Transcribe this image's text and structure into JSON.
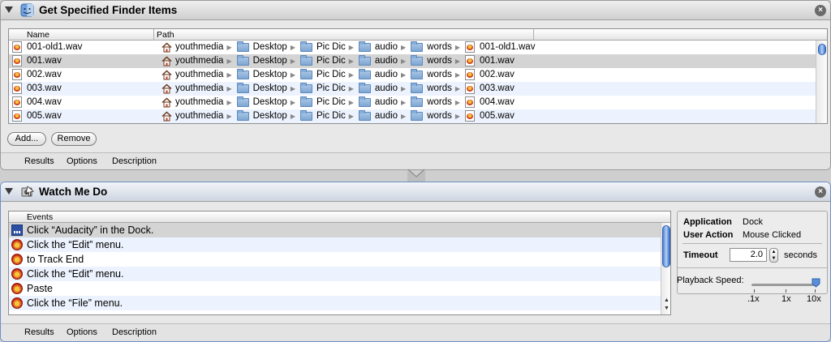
{
  "action1": {
    "title": "Get Specified Finder Items",
    "columns": {
      "name": "Name",
      "path": "Path"
    },
    "rows": [
      {
        "name": "001-old1.wav",
        "path": [
          "youthmedia",
          "Desktop",
          "Pic Dic",
          "audio",
          "words",
          "001-old1.wav"
        ]
      },
      {
        "name": "001.wav",
        "path": [
          "youthmedia",
          "Desktop",
          "Pic Dic",
          "audio",
          "words",
          "001.wav"
        ]
      },
      {
        "name": "002.wav",
        "path": [
          "youthmedia",
          "Desktop",
          "Pic Dic",
          "audio",
          "words",
          "002.wav"
        ]
      },
      {
        "name": "003.wav",
        "path": [
          "youthmedia",
          "Desktop",
          "Pic Dic",
          "audio",
          "words",
          "003.wav"
        ]
      },
      {
        "name": "004.wav",
        "path": [
          "youthmedia",
          "Desktop",
          "Pic Dic",
          "audio",
          "words",
          "004.wav"
        ]
      },
      {
        "name": "005.wav",
        "path": [
          "youthmedia",
          "Desktop",
          "Pic Dic",
          "audio",
          "words",
          "005.wav"
        ]
      }
    ],
    "selected_row": 1,
    "add_label": "Add...",
    "remove_label": "Remove",
    "tabs": [
      "Results",
      "Options",
      "Description"
    ]
  },
  "action2": {
    "title": "Watch Me Do",
    "events_header": "Events",
    "events": [
      {
        "icon": "dock-icon",
        "label": "Click “Audacity” in the Dock."
      },
      {
        "icon": "audacity-icon",
        "label": "Click the “Edit” menu."
      },
      {
        "icon": "audacity-icon",
        "label": "to Track End"
      },
      {
        "icon": "audacity-icon",
        "label": "Click the “Edit” menu."
      },
      {
        "icon": "audacity-icon",
        "label": "Paste"
      },
      {
        "icon": "audacity-icon",
        "label": "Click the “File” menu."
      }
    ],
    "selected_event": 0,
    "details": {
      "application_label": "Application",
      "application_value": "Dock",
      "user_action_label": "User Action",
      "user_action_value": "Mouse Clicked",
      "timeout_label": "Timeout",
      "timeout_value": "2.0",
      "timeout_unit": "seconds"
    },
    "playback": {
      "label": "Playback Speed:",
      "ticks": [
        ".1x",
        "1x",
        "10x"
      ],
      "value_fraction": 1.0
    },
    "tabs": [
      "Results",
      "Options",
      "Description"
    ]
  },
  "colors": {
    "selection": "#d4d4d4",
    "stripe": "#edf3fe",
    "accent_blue": "#3a70c9"
  }
}
